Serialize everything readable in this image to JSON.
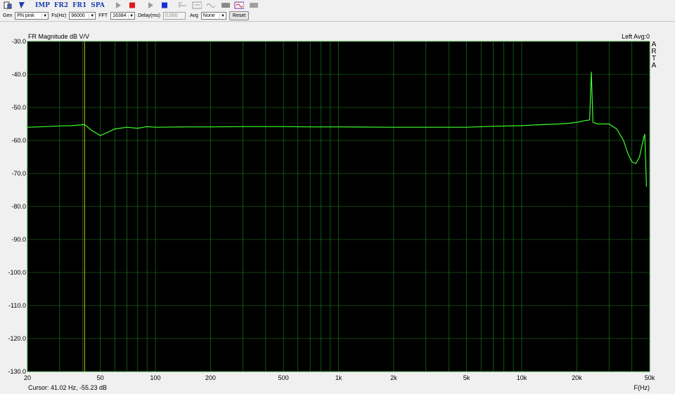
{
  "toolbar": {
    "buttons": [
      {
        "name": "new-icon",
        "label": ""
      },
      {
        "name": "open-icon",
        "label": ""
      },
      {
        "name": "imp-button",
        "label": "IMP"
      },
      {
        "name": "fr2-button",
        "label": "FR2"
      },
      {
        "name": "fr1-button",
        "label": "FR1"
      },
      {
        "name": "spa-button",
        "label": "SPA"
      }
    ]
  },
  "controls": {
    "gen_label": "Gen",
    "gen_value": "PN pink",
    "fs_label": "Fs(Hz)",
    "fs_value": "96000",
    "fft_label": "FFT",
    "fft_value": "16384",
    "delay_label": "Delay(ms)",
    "delay_value": "0.000",
    "avg_label": "Avg",
    "avg_value": "None",
    "reset_label": "Reset"
  },
  "plot": {
    "title": "FR Magnitude dB V/V",
    "status": "Left  Avg:0",
    "brand_letters": [
      "A",
      "R",
      "T",
      "A"
    ],
    "xlabel": "F(Hz)",
    "cursor_text": "Cursor: 41.02 Hz, -55.23 dB",
    "cursor_freq": 41.02,
    "colors": {
      "background": "#000000",
      "grid": "#1f8a1f",
      "trace": "#3cff2a",
      "cursor": "#c8c800"
    }
  },
  "chart_data": {
    "type": "line",
    "title": "FR Magnitude dB V/V",
    "xlabel": "F(Hz)",
    "ylabel": "",
    "x_scale": "log",
    "xlim": [
      20,
      50000
    ],
    "ylim": [
      -130,
      -30
    ],
    "x_ticks": [
      20,
      50,
      100,
      200,
      500,
      1000,
      2000,
      5000,
      10000,
      20000,
      50000
    ],
    "x_tick_labels": [
      "20",
      "50",
      "100",
      "200",
      "500",
      "1k",
      "2k",
      "5k",
      "10k",
      "20k",
      "50k"
    ],
    "y_ticks": [
      -30,
      -40,
      -50,
      -60,
      -70,
      -80,
      -90,
      -100,
      -110,
      -120,
      -130
    ],
    "y_tick_labels": [
      "-30.0",
      "-40.0",
      "-50.0",
      "-60.0",
      "-70.0",
      "-80.0",
      "-90.0",
      "-100.0",
      "-110.0",
      "-120.0",
      "-130.0"
    ],
    "grid": true,
    "series": [
      {
        "x": [
          20,
          25,
          30,
          35,
          41,
          45,
          50,
          55,
          60,
          70,
          80,
          90,
          100,
          150,
          200,
          300,
          500,
          700,
          1000,
          2000,
          3000,
          5000,
          7000,
          10000,
          13000,
          16000,
          18000,
          20000,
          22000,
          23500,
          24000,
          24500,
          26000,
          30000,
          33000,
          36000,
          38000,
          40000,
          42000,
          44000,
          46000,
          47000,
          48000
        ],
        "y": [
          -56,
          -55.8,
          -55.6,
          -55.5,
          -55.2,
          -57,
          -58.5,
          -57.5,
          -56.5,
          -56,
          -56.3,
          -55.8,
          -56,
          -55.9,
          -55.9,
          -55.8,
          -55.8,
          -55.9,
          -55.9,
          -56,
          -56,
          -56,
          -55.7,
          -55.5,
          -55.2,
          -55,
          -54.8,
          -54.5,
          -54,
          -53.8,
          -39.2,
          -54.5,
          -55,
          -55,
          -56.5,
          -60,
          -64,
          -66.5,
          -67,
          -65,
          -60,
          -58,
          -74
        ]
      }
    ]
  }
}
